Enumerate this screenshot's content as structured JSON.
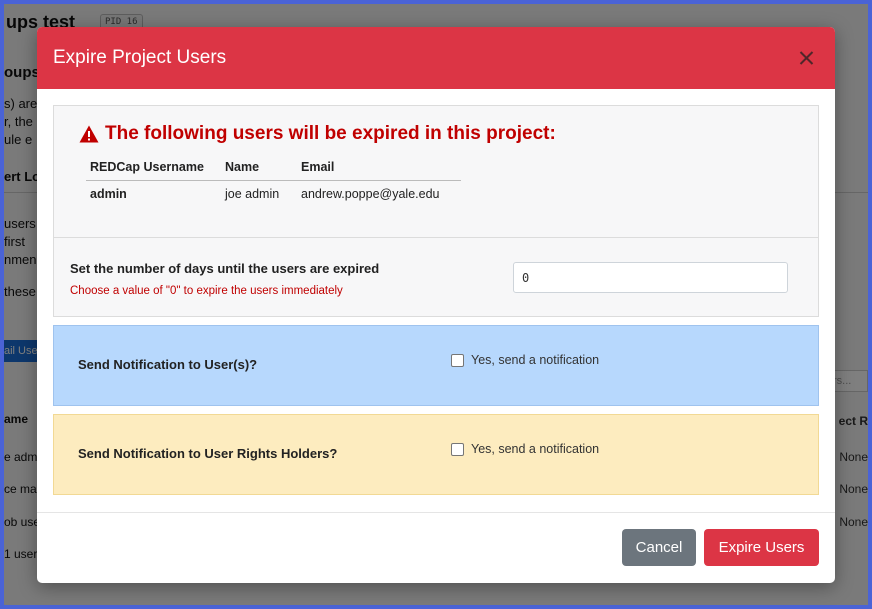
{
  "background": {
    "title_fragment": "ups test",
    "pid_badge": "PID 16",
    "section_fragment": "oups",
    "text_fragments": [
      "s) are",
      "r, the",
      "ule e",
      "ert Lo",
      "users",
      "first",
      "nmen",
      "these"
    ],
    "button_fragment": "ail Use",
    "search_placeholder_fragment": "rs...",
    "table_header_fragment": "ame",
    "right_header_fragment": "ect R",
    "row_fragments": [
      "e adm",
      "ce ma",
      "ob use",
      "1 user"
    ],
    "right_values": [
      "None",
      "None",
      "None"
    ]
  },
  "modal": {
    "title": "Expire Project Users",
    "warning": "The following users will be expired in this project:",
    "table": {
      "headers": [
        "REDCap Username",
        "Name",
        "Email"
      ],
      "rows": [
        {
          "username": "admin",
          "name": "joe admin",
          "email": "andrew.poppe@yale.edu"
        }
      ]
    },
    "days": {
      "label": "Set the number of days until the users are expired",
      "help": "Choose a value of \"0\" to expire the users immediately",
      "value": "0"
    },
    "notify_users": {
      "label": "Send Notification to User(s)?",
      "checkbox_label": "Yes, send a notification",
      "checked": false
    },
    "notify_holders": {
      "label": "Send Notification to User Rights Holders?",
      "checkbox_label": "Yes, send a notification",
      "checked": false
    },
    "buttons": {
      "cancel": "Cancel",
      "expire": "Expire Users"
    }
  },
  "colors": {
    "header_red": "#dc3545",
    "warning_red": "#c00000",
    "notify_users_bg": "#b7d8fd",
    "notify_holders_bg": "#fdecbf",
    "cancel_gray": "#6c757d"
  },
  "icons": {
    "close": "close-icon",
    "warning": "warning-triangle-icon"
  }
}
